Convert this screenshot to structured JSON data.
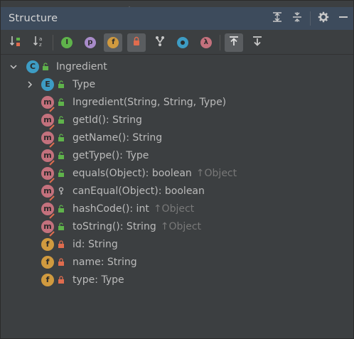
{
  "panel": {
    "title": "Structure"
  },
  "toolbar": {
    "items": [
      {
        "icon": "sort-by-visibility-icon"
      },
      {
        "icon": "sort-alphabetically-icon"
      },
      {
        "icon": "show-inherited-icon",
        "letter": "I"
      },
      {
        "icon": "show-properties-icon",
        "letter": "p"
      },
      {
        "icon": "show-fields-icon",
        "letter": "f",
        "active": true
      },
      {
        "icon": "show-non-public-icon",
        "active": true
      },
      {
        "icon": "show-lambdas-icon"
      },
      {
        "icon": "show-anonymous-icon"
      },
      {
        "icon": "show-lambda-icon",
        "letter": "λ"
      },
      {
        "icon": "autoscroll-to-source-icon",
        "active": true
      },
      {
        "icon": "autoscroll-from-source-icon"
      }
    ]
  },
  "tree": {
    "root": {
      "label": "Ingredient",
      "kind": "C"
    },
    "children": [
      {
        "label": "Type",
        "kind": "E",
        "access": "public",
        "expandable": true
      },
      {
        "label": "Ingredient(String, String, Type)",
        "kind": "m",
        "access": "public"
      },
      {
        "label": "getId(): String",
        "kind": "m",
        "access": "public"
      },
      {
        "label": "getName(): String",
        "kind": "m",
        "access": "public"
      },
      {
        "label": "getType(): Type",
        "kind": "m",
        "access": "public"
      },
      {
        "label": "equals(Object): boolean",
        "inherited": "↑Object",
        "kind": "m",
        "access": "public"
      },
      {
        "label": "canEqual(Object): boolean",
        "kind": "m",
        "access": "protected"
      },
      {
        "label": "hashCode(): int",
        "inherited": "↑Object",
        "kind": "m",
        "access": "public"
      },
      {
        "label": "toString(): String",
        "inherited": "↑Object",
        "kind": "m",
        "access": "public"
      },
      {
        "label": "id: String",
        "kind": "f",
        "access": "private"
      },
      {
        "label": "name: String",
        "kind": "f",
        "access": "private"
      },
      {
        "label": "type: Type",
        "kind": "f",
        "access": "private"
      }
    ]
  },
  "colors": {
    "class": "#3d9cc4",
    "enum": "#3d9cc4",
    "method": "#c4717d",
    "field": "#d09a3f",
    "public": "#5fb34b",
    "private": "#e06c4e"
  }
}
